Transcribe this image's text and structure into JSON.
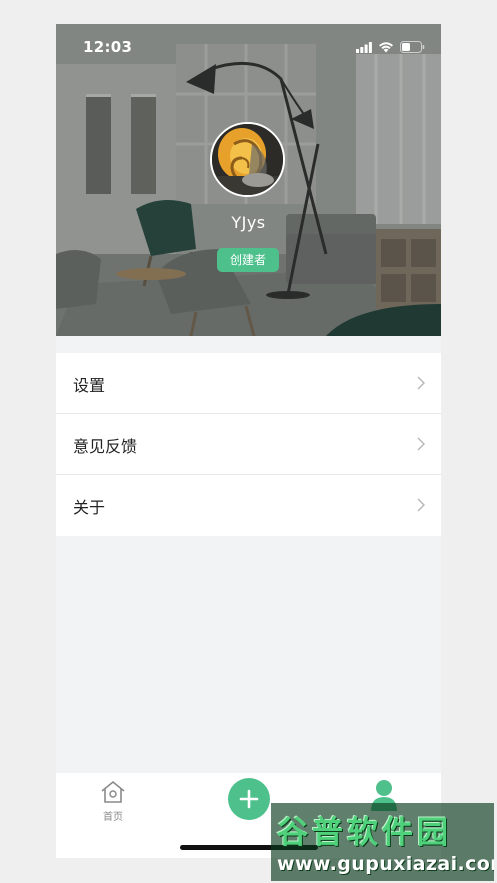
{
  "status_bar": {
    "time": "12:03",
    "icons": [
      "cellular-signal-icon",
      "wifi-icon",
      "battery-icon"
    ]
  },
  "profile": {
    "username": "YJys",
    "role": "创建者",
    "avatar_icon": "nautilus-shell-avatar"
  },
  "menu": {
    "items": [
      {
        "label": "设置",
        "icon": "chevron-right-icon"
      },
      {
        "label": "意见反馈",
        "icon": "chevron-right-icon"
      },
      {
        "label": "关于",
        "icon": "chevron-right-icon"
      }
    ]
  },
  "tabbar": {
    "home_label": "首页",
    "home_icon": "house-icon",
    "add_icon": "plus-icon",
    "mine_icon": "person-icon"
  },
  "colors": {
    "accent": "#4ec08c",
    "background": "#f2f3f5"
  },
  "watermark": {
    "title": "谷普软件园",
    "url": "www.gupuxiazai.com"
  }
}
